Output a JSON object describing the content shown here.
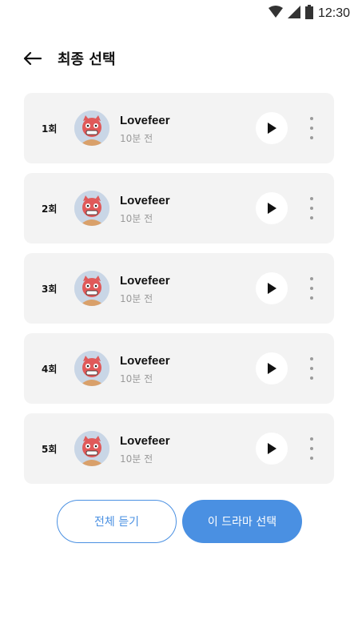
{
  "status": {
    "time": "12:30"
  },
  "header": {
    "title": "최종 선택"
  },
  "items": [
    {
      "episode": "1회",
      "name": "Lovefeer",
      "time": "10분 전"
    },
    {
      "episode": "2회",
      "name": "Lovefeer",
      "time": "10분 전"
    },
    {
      "episode": "3회",
      "name": "Lovefeer",
      "time": "10분 전"
    },
    {
      "episode": "4회",
      "name": "Lovefeer",
      "time": "10분 전"
    },
    {
      "episode": "5회",
      "name": "Lovefeer",
      "time": "10분 전"
    }
  ],
  "actions": {
    "listen_all": "전체 듣기",
    "select_drama": "이 드라마 선택"
  },
  "colors": {
    "accent": "#4a90e2",
    "card_bg": "#f3f3f3"
  }
}
